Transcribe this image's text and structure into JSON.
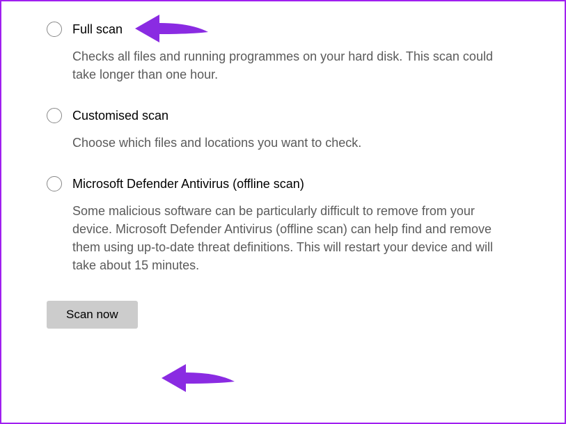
{
  "options": [
    {
      "id": "full-scan",
      "label": "Full scan",
      "description": "Checks all files and running programmes on your hard disk. This scan could take longer than one hour."
    },
    {
      "id": "customised-scan",
      "label": "Customised scan",
      "description": "Choose which files and locations you want to check."
    },
    {
      "id": "offline-scan",
      "label": "Microsoft Defender Antivirus (offline scan)",
      "description": "Some malicious software can be particularly difficult to remove from your device. Microsoft Defender Antivirus (offline scan) can help find and remove them using up-to-date threat definitions. This will restart your device and will take about 15 minutes."
    }
  ],
  "button": {
    "scan_label": "Scan now"
  },
  "annotation_color": "#8a2be2"
}
